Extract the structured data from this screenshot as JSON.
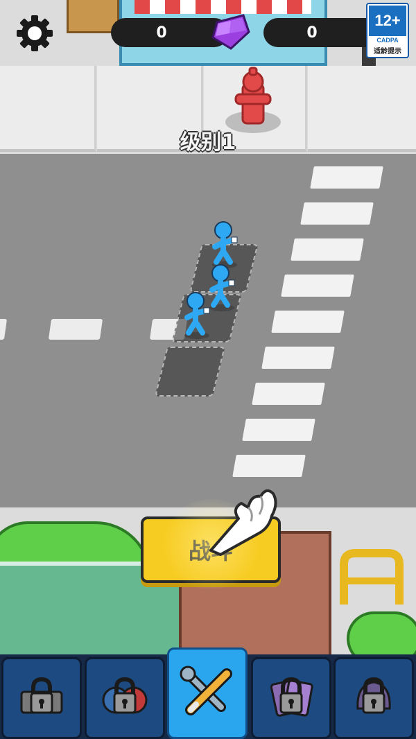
{
  "hud": {
    "gem_count": "0",
    "coin_count": "0",
    "settings_icon": "gear-icon",
    "gem_icon": "purple-gem-icon"
  },
  "age_rating": {
    "rating": "12+",
    "org": "CADPA",
    "caption": "适龄提示"
  },
  "level": {
    "label": "级别1"
  },
  "fight_button": {
    "label": "战斗"
  },
  "nav": {
    "tabs": [
      {
        "name": "locked-gate",
        "icon": "lock-icon",
        "locked": true,
        "active": false
      },
      {
        "name": "locked-shield",
        "icon": "lock-icon",
        "locked": true,
        "active": false
      },
      {
        "name": "weapons",
        "icon": "bat-and-wrench-icon",
        "locked": false,
        "active": true
      },
      {
        "name": "locked-cards",
        "icon": "lock-icon",
        "locked": true,
        "active": false
      },
      {
        "name": "locked-helmet",
        "icon": "lock-icon",
        "locked": true,
        "active": false
      }
    ]
  },
  "colors": {
    "player_blue": "#2ea8f2",
    "button_yellow": "#f7cc22",
    "nav_dark": "#162a47",
    "nav_active": "#2aa6ef"
  }
}
